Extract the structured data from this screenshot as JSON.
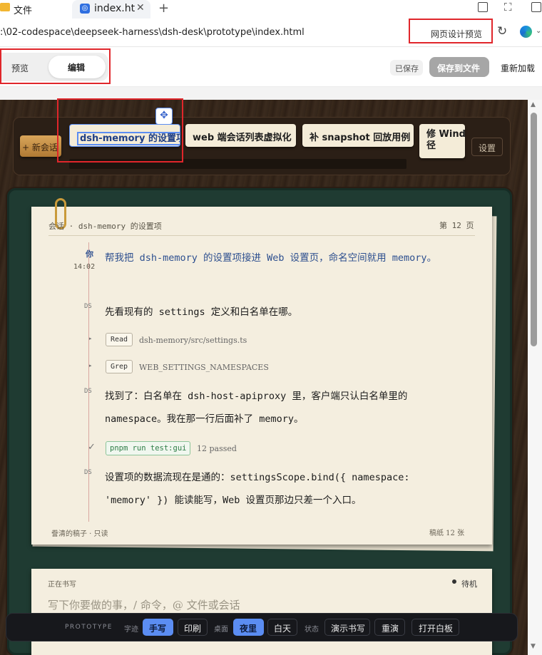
{
  "browser": {
    "tab_title": "文件",
    "active_tab_title": "index.ht",
    "address": ":\\02-codespace\\deepseek-harness\\dsh-desk\\prototype\\index.html",
    "webpage_preview_label": "网页设计预览"
  },
  "toolbar": {
    "mode_preview": "预览",
    "mode_edit": "编辑",
    "saved_status": "已保存",
    "save_to_file": "保存到文件",
    "reload": "重新加载"
  },
  "session_bar": {
    "new_session": "+ 新会话",
    "tabs": [
      "dsh-memory 的设置项",
      "web 端会话列表虚拟化",
      "补 snapshot 回放用例",
      "修 Windo\n径"
    ],
    "settings": "设置"
  },
  "page": {
    "header_left": "会话 · dsh-memory 的设置项",
    "header_right": "第 12 页",
    "footer_left": "誊清的稿子 · 只读",
    "footer_right": "稿纸 12 张"
  },
  "messages": [
    {
      "who": "你",
      "time": "14:02",
      "text": "帮我把 dsh-memory 的设置项接进 Web 设置页，命名空间就用 memory。"
    },
    {
      "who": "DS",
      "text": "先看现有的 settings 定义和白名单在哪。"
    },
    {
      "tool": "Read",
      "arg": "dsh-memory/src/settings.ts"
    },
    {
      "tool": "Grep",
      "arg": "WEB_SETTINGS_NAMESPACES"
    },
    {
      "who": "DS",
      "text": "找到了：白名单在 dsh-host-apiproxy 里，客户端只认白名单里的 namespace。我在那一行后面补了 memory。"
    },
    {
      "check": "✓",
      "command": "pnpm run test:gui",
      "result": "12 passed"
    },
    {
      "who": "DS",
      "text": "设置项的数据流现在是通的：settingsScope.bind({ namespace: 'memory' }) 能读能写，Web 设置页那边只差一个入口。"
    }
  ],
  "composer": {
    "label": "正在书写",
    "status": "待机",
    "placeholder": "写下你要做的事，/ 命令，@ 文件或会话"
  },
  "prototype_bar": {
    "brand": "PROTOTYPE",
    "handwriting_label": "字迹",
    "handwriting_opt1": "手写",
    "handwriting_opt2": "印刷",
    "desk_label": "桌面",
    "desk_opt1": "夜里",
    "desk_opt2": "白天",
    "state_label": "状态",
    "demo_writing": "演示书写",
    "replay": "重演",
    "open_board": "打开白板"
  },
  "colors": {
    "accent_blue": "#5b8df2",
    "ink_blue": "#2d4f8f",
    "paper": "#f4eedf",
    "desk_green": "#1f3b32",
    "red_annotation": "#e0262b"
  }
}
